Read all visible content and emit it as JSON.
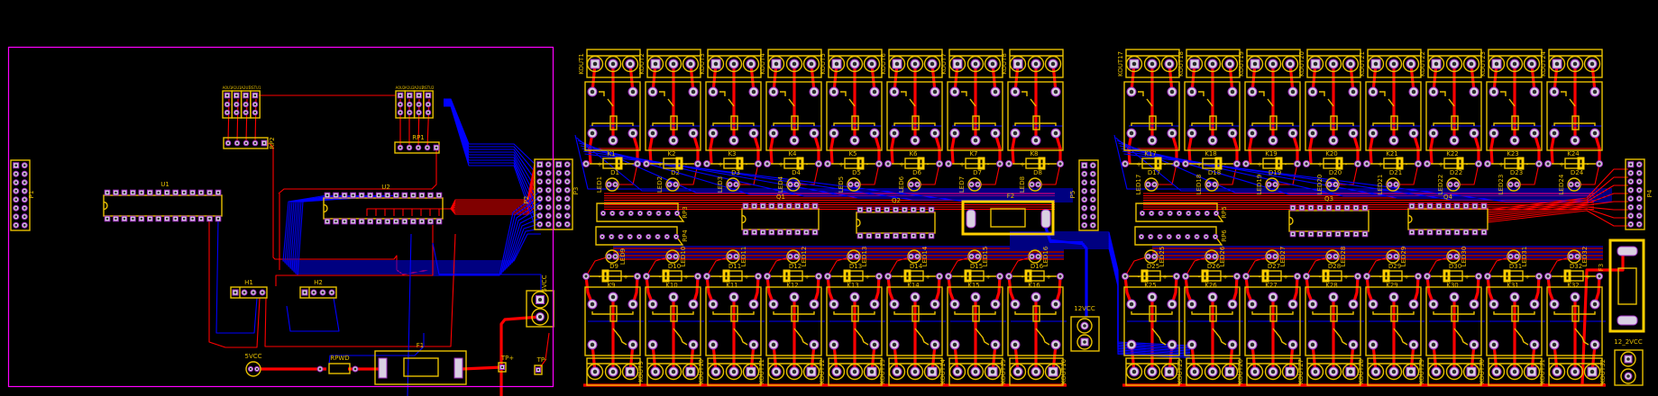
{
  "colors": {
    "background": "#000000",
    "board_outline": "#ff00ff",
    "silkscreen": "#e8c000",
    "top_copper": "#ff0000",
    "bottom_copper": "#0000ff",
    "pad": "#d9d0e2"
  },
  "control_board": {
    "P1": "P1",
    "U1": "U1",
    "U2": "U2",
    "RP1": "RP1",
    "RP2": "RP2",
    "H1": "H1",
    "H2": "H2",
    "F1": "F1",
    "RPWD": "RPWD",
    "vcc5_round": "5VCC",
    "vcc5_conn": "5VCC",
    "tp_plus": "TP+",
    "tp_minus": "TP-",
    "P2": "P2",
    "P3": "P3",
    "jumpers_u1": [
      "A0U1",
      "A1U1",
      "A2U1",
      "RSTU1"
    ],
    "jumpers_u2": [
      "A0U2",
      "A1U2",
      "A2U2",
      "RSTU2"
    ]
  },
  "relay_group_1": {
    "top": [
      {
        "k": "K1",
        "kout": "KOUT1",
        "d": "D1",
        "led": "LED1"
      },
      {
        "k": "K2",
        "kout": "KOUT2",
        "d": "D2",
        "led": "LED2"
      },
      {
        "k": "K3",
        "kout": "KOUT3",
        "d": "D3",
        "led": "LED3"
      },
      {
        "k": "K4",
        "kout": "KOUT4",
        "d": "D4",
        "led": "LED4"
      },
      {
        "k": "K5",
        "kout": "KOUT5",
        "d": "D5",
        "led": "LED5"
      },
      {
        "k": "K6",
        "kout": "KOUT6",
        "d": "D6",
        "led": "LED6"
      },
      {
        "k": "K7",
        "kout": "KOUT7",
        "d": "D7",
        "led": "LED7"
      },
      {
        "k": "K8",
        "kout": "KOUT8",
        "d": "D8",
        "led": "LED8"
      }
    ],
    "bottom": [
      {
        "k": "K9",
        "kout": "KOUT9",
        "d": "D9",
        "led": "LED9"
      },
      {
        "k": "K10",
        "kout": "KOUT10",
        "d": "D10",
        "led": "LED10"
      },
      {
        "k": "K11",
        "kout": "KOUT11",
        "d": "D11",
        "led": "LED11"
      },
      {
        "k": "K12",
        "kout": "KOUT12",
        "d": "D12",
        "led": "LED12"
      },
      {
        "k": "K13",
        "kout": "KOUT13",
        "d": "D13",
        "led": "LED13"
      },
      {
        "k": "K14",
        "kout": "KOUT14",
        "d": "D14",
        "led": "LED14"
      },
      {
        "k": "K15",
        "kout": "KOUT15",
        "d": "D15",
        "led": "LED15"
      },
      {
        "k": "K16",
        "kout": "KOUT16",
        "d": "D16",
        "led": "LED16"
      }
    ],
    "RP_a": "RP3",
    "RP_b": "RP4",
    "Q_a": "Q1",
    "Q_b": "Q2",
    "fuse": "F2",
    "header": "P5",
    "power_conn": "12VCC"
  },
  "relay_group_2": {
    "top": [
      {
        "k": "K17",
        "kout": "KOUT17",
        "d": "D17",
        "led": "LED17"
      },
      {
        "k": "K18",
        "kout": "KOUT18",
        "d": "D18",
        "led": "LED18"
      },
      {
        "k": "K19",
        "kout": "KOUT19",
        "d": "D19",
        "led": "LED19"
      },
      {
        "k": "K20",
        "kout": "KOUT20",
        "d": "D20",
        "led": "LED20"
      },
      {
        "k": "K21",
        "kout": "KOUT21",
        "d": "D21",
        "led": "LED21"
      },
      {
        "k": "K22",
        "kout": "KOUT22",
        "d": "D22",
        "led": "LED22"
      },
      {
        "k": "K23",
        "kout": "KOUT23",
        "d": "D23",
        "led": "LED23"
      },
      {
        "k": "K24",
        "kout": "KOUT24",
        "d": "D24",
        "led": "LED24"
      }
    ],
    "bottom": [
      {
        "k": "K25",
        "kout": "KOUT25",
        "d": "D25",
        "led": "LED25"
      },
      {
        "k": "K26",
        "kout": "KOUT26",
        "d": "D26",
        "led": "LED26"
      },
      {
        "k": "K27",
        "kout": "KOUT27",
        "d": "D27",
        "led": "LED27"
      },
      {
        "k": "K28",
        "kout": "KOUT28",
        "d": "D28",
        "led": "LED28"
      },
      {
        "k": "K29",
        "kout": "KOUT29",
        "d": "D29",
        "led": "LED29"
      },
      {
        "k": "K30",
        "kout": "KOUT30",
        "d": "D30",
        "led": "LED30"
      },
      {
        "k": "K31",
        "kout": "KOUT31",
        "d": "D31",
        "led": "LED31"
      },
      {
        "k": "K32",
        "kout": "KOUT32",
        "d": "D32",
        "led": "LED32"
      }
    ],
    "RP_a": "RP5",
    "RP_b": "RP6",
    "Q_a": "Q3",
    "Q_b": "Q4",
    "fuse": "F3",
    "header": "P4",
    "power_conn": "12_2VCC"
  }
}
